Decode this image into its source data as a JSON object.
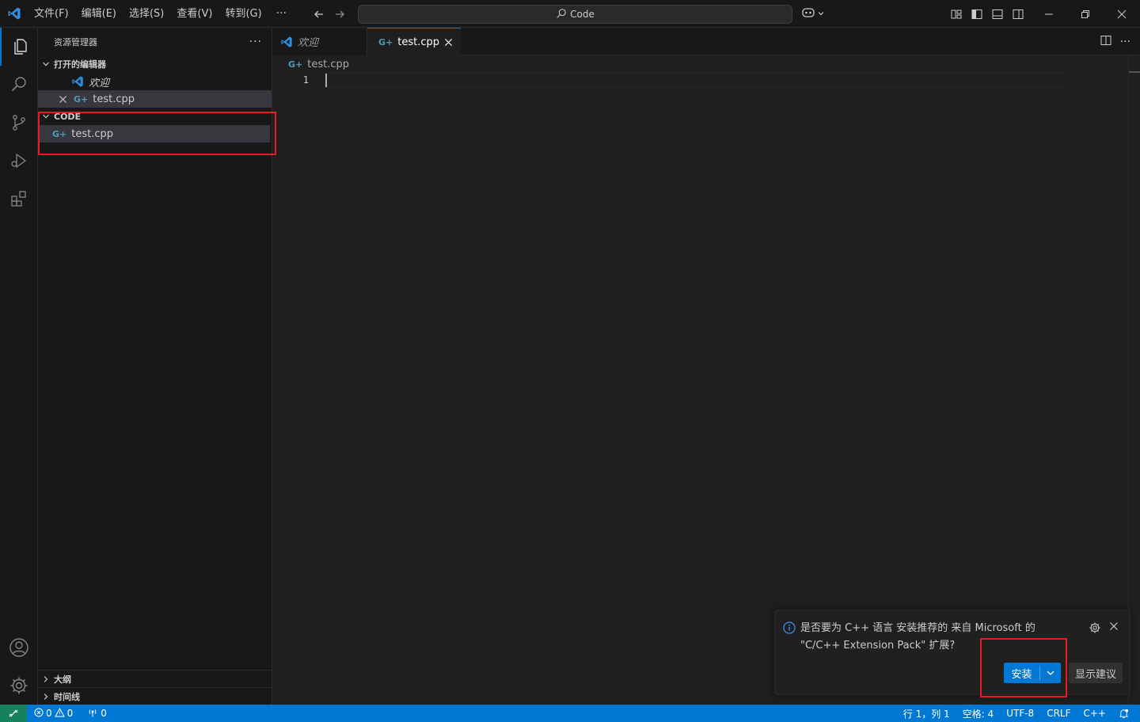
{
  "titlebar": {
    "menu": [
      "文件(F)",
      "编辑(E)",
      "选择(S)",
      "查看(V)",
      "转到(G)"
    ],
    "more": "···",
    "search_text": "Code"
  },
  "sidebar": {
    "title": "资源管理器",
    "more": "···",
    "open_editors": {
      "label": "打开的编辑器",
      "items": [
        {
          "label": "欢迎",
          "icon": "vscode-icon"
        },
        {
          "label": "test.cpp",
          "icon": "cpp-file-icon"
        }
      ]
    },
    "folder": {
      "label": "CODE",
      "items": [
        {
          "label": "test.cpp",
          "icon": "cpp-file-icon"
        }
      ]
    },
    "outline_label": "大纲",
    "timeline_label": "时间线"
  },
  "tabs": [
    {
      "label": "欢迎",
      "active": false
    },
    {
      "label": "test.cpp",
      "active": true
    }
  ],
  "breadcrumb": "test.cpp",
  "editor": {
    "line_number": "1"
  },
  "notification": {
    "message": "是否要为 C++ 语言 安装推荐的 来自 Microsoft 的 \"C/C++ Extension Pack\" 扩展?",
    "install_label": "安装",
    "show_label": "显示建议"
  },
  "statusbar": {
    "errors": "0",
    "warnings": "0",
    "ports": "0",
    "position": "行 1，列 1",
    "indent": "空格: 4",
    "encoding": "UTF-8",
    "eol": "CRLF",
    "language": "C++"
  },
  "colors": {
    "accent": "#0078d4",
    "remote": "#16825d",
    "highlight_box": "#e51c23",
    "cpp_icon": "#519aba"
  }
}
